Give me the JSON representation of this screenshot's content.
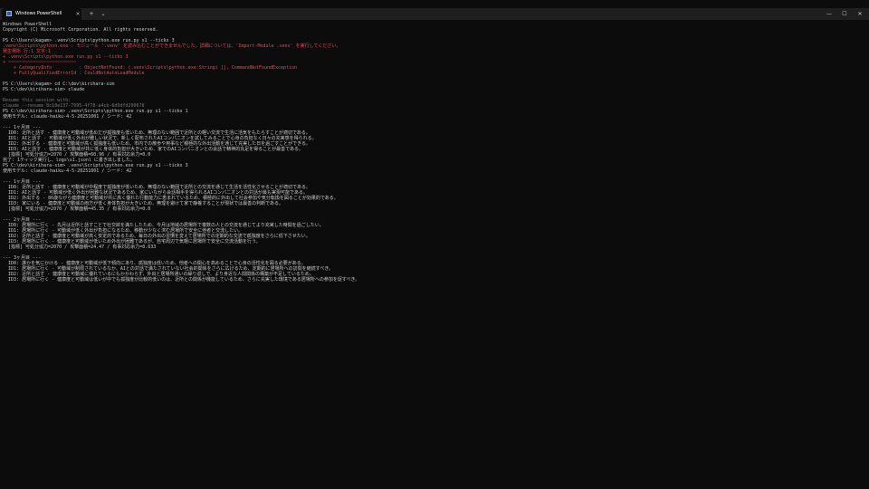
{
  "window": {
    "tab_title": "Windows PowerShell",
    "tab_close": "×",
    "new_tab": "+",
    "dropdown": "⌄",
    "minimize": "—",
    "maximize": "☐",
    "close": "✕"
  },
  "colors": {
    "background": "#0c0c0c",
    "titlebar": "#1f1f1f",
    "text": "#cccccc",
    "error": "#e74856",
    "dim": "#767676",
    "command": "#f9f1a5"
  },
  "terminal": {
    "lines": [
      {
        "text": "Windows PowerShell",
        "style": ""
      },
      {
        "text": "Copyright (C) Microsoft Corporation. All rights reserved.",
        "style": ""
      },
      {
        "text": "",
        "style": ""
      },
      {
        "text": "PS C:\\Users\\kagam> .venv\\Scripts\\python.exe run.py s1 --ticks 3",
        "style": ""
      },
      {
        "text": ".venv\\Scripts\\python.exe : モジュール '.venv' を読み込むことができませんでした。詳細については、'Import-Module .venv' を実行してください。",
        "style": "err"
      },
      {
        "text": "発生場所 行:1 文字:1",
        "style": "err"
      },
      {
        "text": "+ .venv\\Scripts\\python.exe run.py s1 --ticks 3",
        "style": "err"
      },
      {
        "text": "+ ~~~~~~~~~~~~~~~~~~~~~~~~~",
        "style": "err"
      },
      {
        "text": "    + CategoryInfo          : ObjectNotFound: (.venv\\Scripts\\python.exe:String) [], CommandNotFoundException",
        "style": "err"
      },
      {
        "text": "    + FullyQualifiedErrorId : CouldNotAutoLoadModule",
        "style": "err"
      },
      {
        "text": "",
        "style": ""
      },
      {
        "text": "PS C:\\Users\\kagam> cd C:\\dev\\kirihara-sim",
        "style": ""
      },
      {
        "text": "PS C:\\dev\\kirihara-sim> claude",
        "style": ""
      },
      {
        "text": "",
        "style": ""
      },
      {
        "text": "Resume this session with:",
        "style": "dim"
      },
      {
        "text": "claude --resume 8c10e137-7995-4f78-a4cb-6d9dfd290678",
        "style": "dim"
      },
      {
        "text": "PS C:\\dev\\kirihara-sim> .venv\\Scripts\\python.exe run.py s1 --ticks 1",
        "style": ""
      },
      {
        "text": "使用モデル: claude-haiku-4-5-20251001 / シード: 42",
        "style": ""
      },
      {
        "text": "",
        "style": ""
      },
      {
        "text": "--- 1ヶ月目 ---",
        "style": ""
      },
      {
        "text": "  ID0: 近所と話す - 健康度と可動域が低めだが孤独度も低いため、無理のない範囲で近所との軽い交流で生活に活気をもたらすことが適切である。",
        "style": ""
      },
      {
        "text": "  ID1: AIと話す - 可動域が低く外出が難しい状況で、新しく配布されたAIコンパニオンを試してみることで心身の負担なく日々の充実感を得られる。",
        "style": ""
      },
      {
        "text": "  ID2: 外出する - 健康度と可動域が高く孤独度も低いため、市内での散歩や用事など積極的な外出活動を通じて充実した日を過ごすことができる。",
        "style": ""
      },
      {
        "text": "  ID3: AIと話す - 健康度と可動域が共に低く身体的負担が大きいため、家でのAIコンパニオンとの会話で精神的充足を得ることが最善である。",
        "style": ""
      },
      {
        "text": "  [指標] 可処分協力=2070 / 攻撃面積=60.96 / 有事対応余力=0.0",
        "style": ""
      },
      {
        "text": "完了: 1ティック実行し、logs\\s1.jsonl に書き出しました。",
        "style": ""
      },
      {
        "text": "PS C:\\dev\\kirihara-sim> .venv\\Scripts\\python.exe run.py s1 --ticks 3",
        "style": ""
      },
      {
        "text": "使用モデル: claude-haiku-4-5-20251001 / シード: 42",
        "style": ""
      },
      {
        "text": "",
        "style": ""
      },
      {
        "text": "--- 1ヶ月目 ---",
        "style": ""
      },
      {
        "text": "  ID0: 近所と話す - 健康度と可動域が中程度で孤独度が低いため、無理のない範囲で近所との交流を通じて生活を活性化させることが適切である。",
        "style": ""
      },
      {
        "text": "  ID1: AIと話す - 可動域が低く外出が困難な状況であるため、家にいながら会話相手を得られるAIコンパニオンとの対話が最も実現可能である。",
        "style": ""
      },
      {
        "text": "  ID2: 外出する - 86歳ながら健康度と可動域が共に高く優れた行動能力に恵まれているため、積極的に外出して社会参加や気分転換を図ることが効果的である。",
        "style": ""
      },
      {
        "text": "  ID3: 家にいる - 健康度と可動域の両方が低く身体負担が大きいため、無理を避けて家で静養することが現状では最善の判断である。",
        "style": ""
      },
      {
        "text": "  [指標] 可処分協力=2070 / 攻撃面積=45.35 / 有事対応余力=0.0",
        "style": ""
      },
      {
        "text": "",
        "style": ""
      },
      {
        "text": "--- 2ヶ月目 ---",
        "style": ""
      },
      {
        "text": "  ID0: 居場所に行く - 先月は近所と話すことで社交欲を満たしたため、今月は地域の居場所で複数の人との交流を通じてより充実した時間を過ごしたい。",
        "style": ""
      },
      {
        "text": "  ID1: 居場所に行く - 可動域が低く外出が負担になるため、移動が少なく済む居場所で安全に他者と交流したい。",
        "style": ""
      },
      {
        "text": "  ID2: 近所と話す - 健康度と可動域が高く安定的であるため、毎日の外出の習慣を変えて居場所での定期的な交流で孤独度をさらに低下させたい。",
        "style": ""
      },
      {
        "text": "  ID3: 居場所に行く - 健康度と可動域が低いため外出が困難であるが、自宅周辺で気軽に居場所で安全に交流活動を行う。",
        "style": ""
      },
      {
        "text": "  [指標] 可処分協力=2070 / 攻撃面積=24.47 / 有事対応余力=0.633",
        "style": ""
      },
      {
        "text": "",
        "style": ""
      },
      {
        "text": "--- 3ヶ月目 ---",
        "style": ""
      },
      {
        "text": "  ID0: 誰かを気にかける - 健康度と可動域が低下傾向にあり、孤独度は低いため、他者への関心を高めることで心身の活性化を図る必要がある。",
        "style": ""
      },
      {
        "text": "  ID1: 居場所に行く - 可動域が制限されているなか、AIとの対話で満たされていない社会的関係をさらに広げるため、定期的に居場所への訪問を継続すべき。",
        "style": ""
      },
      {
        "text": "  ID2: 近所と話す - 健康度と可動域に優れているにもかかわらず、外出と居場所通いの繰り返しで、より身近な人間関係の構築が不足しているため。",
        "style": ""
      },
      {
        "text": "  ID3: 居場所に行く - 健康度と可動域は低いが中でも孤独度が比較的低いのは、近所との関係が機能しているため、さらに充実した環境である居場所への参加を促すべき。",
        "style": ""
      }
    ]
  }
}
